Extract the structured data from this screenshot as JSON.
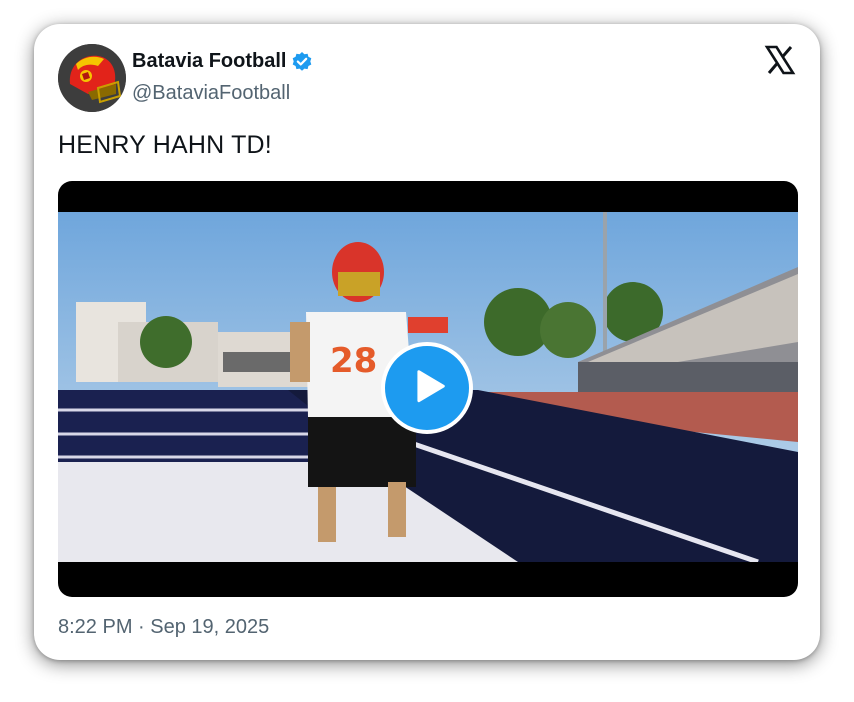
{
  "account": {
    "display_name": "Batavia Football",
    "handle": "@BataviaFootball"
  },
  "tweet": {
    "text": "HENRY HAHN TD!",
    "timestamp": "8:22 PM · Sep 19, 2025"
  },
  "media": {
    "type": "video",
    "jersey_number": "28"
  },
  "icons": {
    "verified": "verified-badge-icon",
    "platform": "x-logo-icon",
    "play": "play-icon"
  },
  "colors": {
    "verified_blue": "#1d9bf0",
    "text_primary": "#0f1419",
    "text_secondary": "#536471"
  }
}
